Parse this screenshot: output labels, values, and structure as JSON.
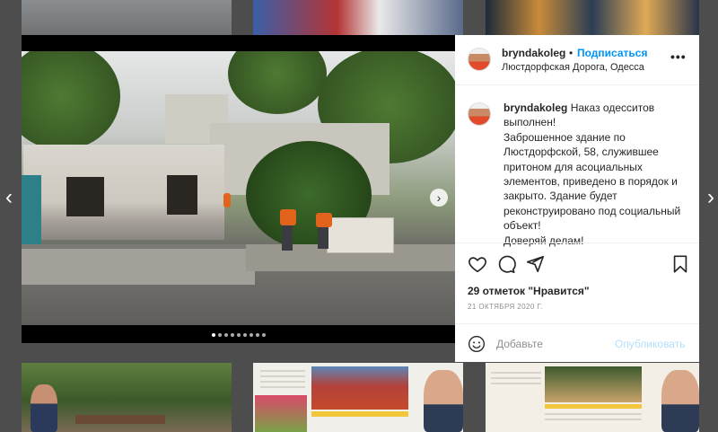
{
  "post": {
    "username": "bryndakoleg",
    "separator": "•",
    "follow_label": "Подписаться",
    "location": "Люстдорфская Дорога, Одесса",
    "more_label": "•••"
  },
  "caption": {
    "username": "bryndakoleg",
    "lines": [
      "Наказ одесситов",
      "выполнен!",
      "Заброшенное здание по",
      "Люстдорфской, 58, служившее",
      "притоном для асоциальных",
      "элементов, приведено в порядок и",
      "закрыто. Здание будет",
      "реконструировано под социальный",
      "объект!",
      "Доверяй делам!"
    ]
  },
  "stats": {
    "likes": "29 отметок \"Нравится\"",
    "date": "21 ОКТЯБРЯ 2020 Г."
  },
  "comment": {
    "placeholder": "Добавьте",
    "publish_label": "Опубликовать"
  },
  "carousel": {
    "count": 9,
    "active": 1,
    "next": "›"
  },
  "nav": {
    "prev": "‹",
    "next": "›"
  },
  "colors": {
    "link_blue": "#0095f6",
    "publish_disabled": "#b2dffc",
    "text": "#262626",
    "muted": "#8e8e8e",
    "overlay": "#4d4d4d"
  }
}
